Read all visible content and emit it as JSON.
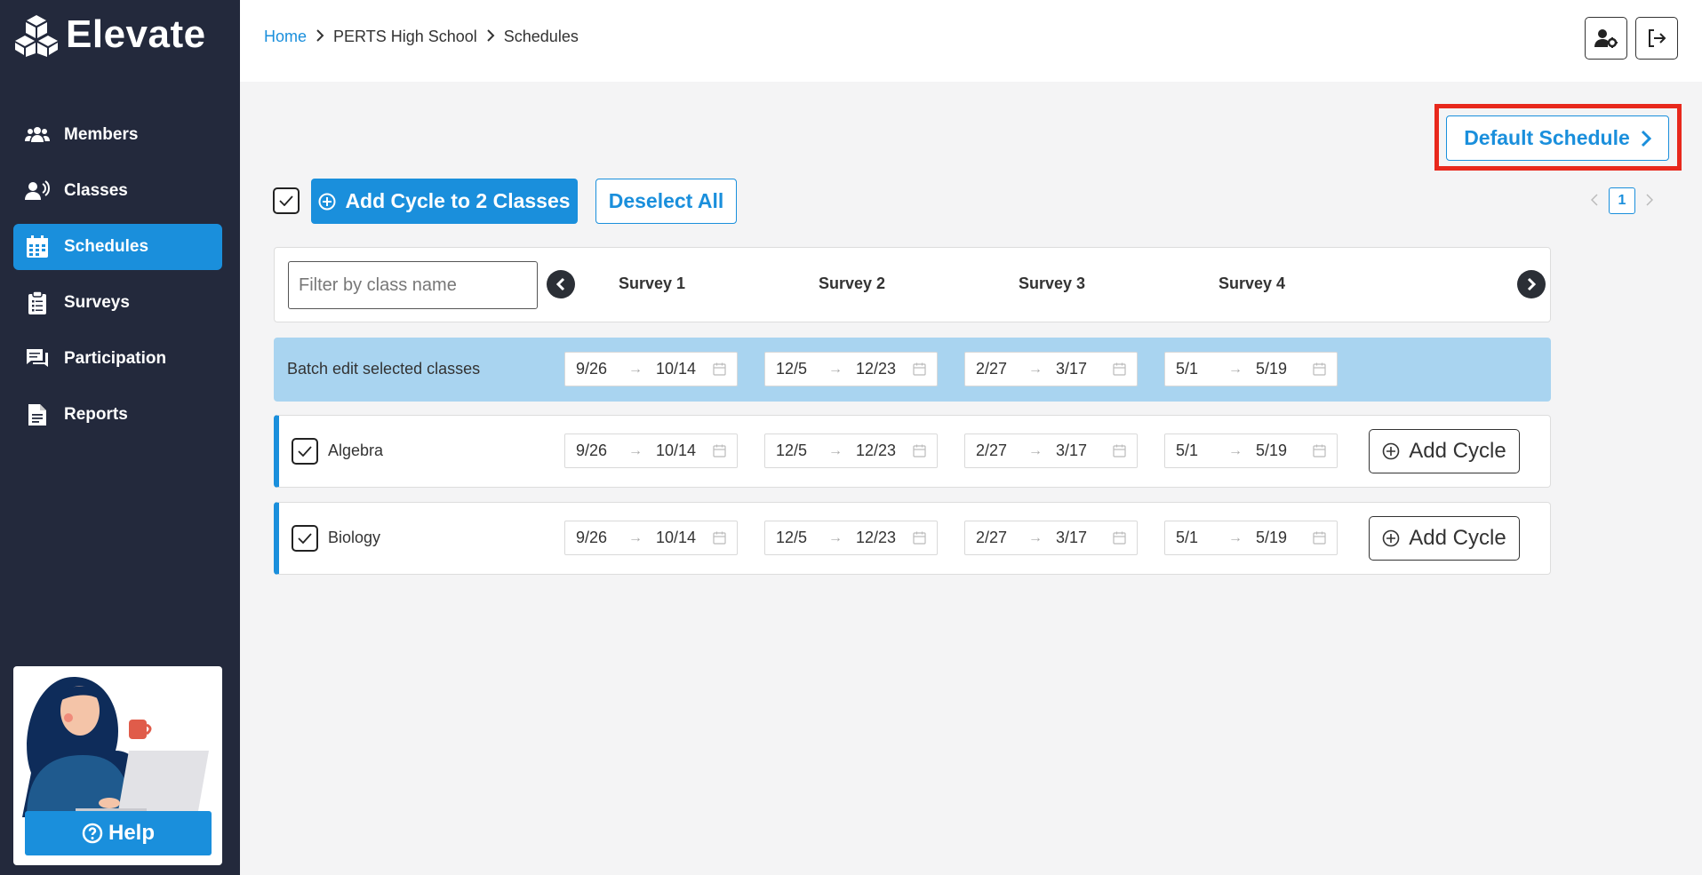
{
  "app": {
    "name": "Elevate"
  },
  "sidebar": {
    "items": [
      {
        "label": "Members",
        "icon": "users-icon"
      },
      {
        "label": "Classes",
        "icon": "classes-icon"
      },
      {
        "label": "Schedules",
        "icon": "calendar-icon",
        "active": true
      },
      {
        "label": "Surveys",
        "icon": "clipboard-icon"
      },
      {
        "label": "Participation",
        "icon": "chat-icon"
      },
      {
        "label": "Reports",
        "icon": "document-icon"
      }
    ],
    "help_label": "Help"
  },
  "breadcrumb": {
    "home": "Home",
    "school": "PERTS High School",
    "current": "Schedules"
  },
  "header": {
    "account_icon": "user-settings-icon",
    "logout_icon": "logout-icon"
  },
  "default_schedule_label": "Default Schedule",
  "toolbar": {
    "add_cycle_label": "Add Cycle to 2 Classes",
    "deselect_label": "Deselect All"
  },
  "pagination": {
    "current_page": "1"
  },
  "table": {
    "filter_placeholder": "Filter by class name",
    "surveys": [
      "Survey 1",
      "Survey 2",
      "Survey 3",
      "Survey 4"
    ],
    "batch": {
      "label": "Batch edit selected classes",
      "ranges": [
        {
          "start": "9/26",
          "end": "10/14"
        },
        {
          "start": "12/5",
          "end": "12/23"
        },
        {
          "start": "2/27",
          "end": "3/17"
        },
        {
          "start": "5/1",
          "end": "5/19"
        }
      ]
    },
    "classes": [
      {
        "name": "Algebra",
        "checked": true,
        "ranges": [
          {
            "start": "9/26",
            "end": "10/14"
          },
          {
            "start": "12/5",
            "end": "12/23"
          },
          {
            "start": "2/27",
            "end": "3/17"
          },
          {
            "start": "5/1",
            "end": "5/19"
          }
        ]
      },
      {
        "name": "Biology",
        "checked": true,
        "ranges": [
          {
            "start": "9/26",
            "end": "10/14"
          },
          {
            "start": "12/5",
            "end": "12/23"
          },
          {
            "start": "2/27",
            "end": "3/17"
          },
          {
            "start": "5/1",
            "end": "5/19"
          }
        ]
      }
    ],
    "add_cycle_label": "Add Cycle",
    "range_arrow": "→"
  },
  "colors": {
    "sidebar_bg": "#23293c",
    "accent": "#1a8fdc",
    "batch_bg": "#a9d4f0",
    "highlight": "#e8281c"
  }
}
